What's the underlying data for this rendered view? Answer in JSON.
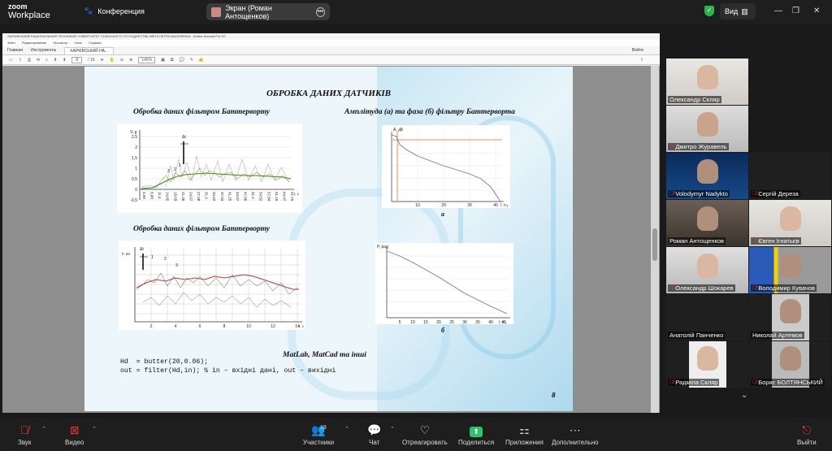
{
  "topbar": {
    "app_name_1": "zoom",
    "app_name_2": "Workplace",
    "meeting_label": "Конференция",
    "screen_share_label": "Экран (Роман Антощенков)",
    "view_label": "Вид",
    "colors": {
      "bg": "#1e1e1e",
      "secure": "#2fb34a"
    }
  },
  "acrobat": {
    "title": "ХАРКІВСЬКИЙ НАЦІОНАЛЬНИЙ ТЕХНІЧНИЙ УНІВЕРСИТЕТ СІЛЬСЬКОГО ГОСПОДАРСТВА ІМЕНІ ПЕТРА ВАСИЛЕНКА - Adobe Acrobat Pro DC",
    "menu": [
      "Файл",
      "Редактирование",
      "Просмотр",
      "Окно",
      "Справка"
    ],
    "tabs": {
      "home": "Главная",
      "tools": "Инструменты",
      "doc": "ХАРКІВСЬКИЙ НА..."
    },
    "signin": "Войти",
    "page_current": "8",
    "page_total": "/ 16",
    "zoom": "145%"
  },
  "slide": {
    "title": "ОБРОБКА ДАНИХ ДАТЧИКІВ",
    "left_top_title": "Обробка даних фільтром Баттерворту",
    "right_top_title": "Амплітуда (а) та фаза (б) фільтру Баттерворта",
    "left_bottom_title": "Обробка даних фільтром Баттерворту",
    "fig_a": "а",
    "fig_b": "б",
    "footer_title": "MatLab, MatCad та інші",
    "code_line1": "Hd  = butter(20,0.06);",
    "code_line2": "out = filter(Hd,in); % in – вхідні дані, out – вихідні",
    "page_number": "8",
    "chart1": {
      "ylabel": "V, g",
      "yticks": [
        "2,5",
        "2",
        "1,5",
        "1",
        "0,5",
        "0",
        "-0,5",
        "-1"
      ],
      "xticks": [
        "4,68",
        "8,08",
        "11,4",
        "14,65",
        "18,03",
        "21,35",
        "24,67",
        "27,98",
        "31,3",
        "34,62",
        "37,93",
        "41,25",
        "44,57",
        "47,88",
        "51,2",
        "54,52",
        "57,84",
        "61,15",
        "64,47",
        "67,79"
      ],
      "xlabel": "t, c",
      "annotation": "Δt",
      "curve_labels": [
        "1",
        "2",
        "3"
      ]
    },
    "chart_a": {
      "ylabel": "A, дБ",
      "xticks": [
        "10",
        "20",
        "30",
        "40"
      ],
      "xlabel": "f, Гц"
    },
    "chart_b": {
      "ylabel": "P, рад",
      "xticks": [
        "5",
        "10",
        "15",
        "20",
        "25",
        "30",
        "35",
        "40",
        "45"
      ],
      "xlabel": "f, Гц"
    },
    "chart2": {
      "ylabel": "F, кН",
      "annotation": "Δt",
      "xticks": [
        "2",
        "4",
        "6",
        "8",
        "10",
        "12",
        "14"
      ],
      "xlabel": "t, c",
      "curve_labels": [
        "1",
        "2",
        "3"
      ]
    }
  },
  "participants": [
    {
      "name": "Олександр Скляр",
      "muted": false,
      "active": false
    },
    {
      "name": "Дмитро Журавель",
      "muted": true,
      "active": false
    },
    {
      "name": "Volodymyr Nadykto",
      "muted": true,
      "active": false
    },
    {
      "name": "Сергій Дереза",
      "muted": true,
      "active": false
    },
    {
      "name": "Роман Антощенков",
      "muted": false,
      "active": true
    },
    {
      "name": "Євген Ігнатьєв",
      "muted": true,
      "active": false
    },
    {
      "name": "Олександр Шокарев",
      "muted": true,
      "active": false
    },
    {
      "name": "Володимир Кувачов",
      "muted": true,
      "active": false
    },
    {
      "name": "Анатолій Панченко",
      "muted": false,
      "active": false
    },
    {
      "name": "Николай Артемов",
      "muted": false,
      "active": false
    },
    {
      "name": "Радміла Скляр",
      "muted": true,
      "active": false
    },
    {
      "name": "Борис БОЛТЯНСЬКИЙ",
      "muted": true,
      "active": false
    }
  ],
  "toolbar": {
    "audio": "Звук",
    "video": "Видео",
    "participants": "Участники",
    "participants_count": "18",
    "chat": "Чат",
    "react": "Отреагировать",
    "share": "Поделиться",
    "apps": "Приложения",
    "more": "Дополнительно",
    "leave": "Выйти"
  }
}
